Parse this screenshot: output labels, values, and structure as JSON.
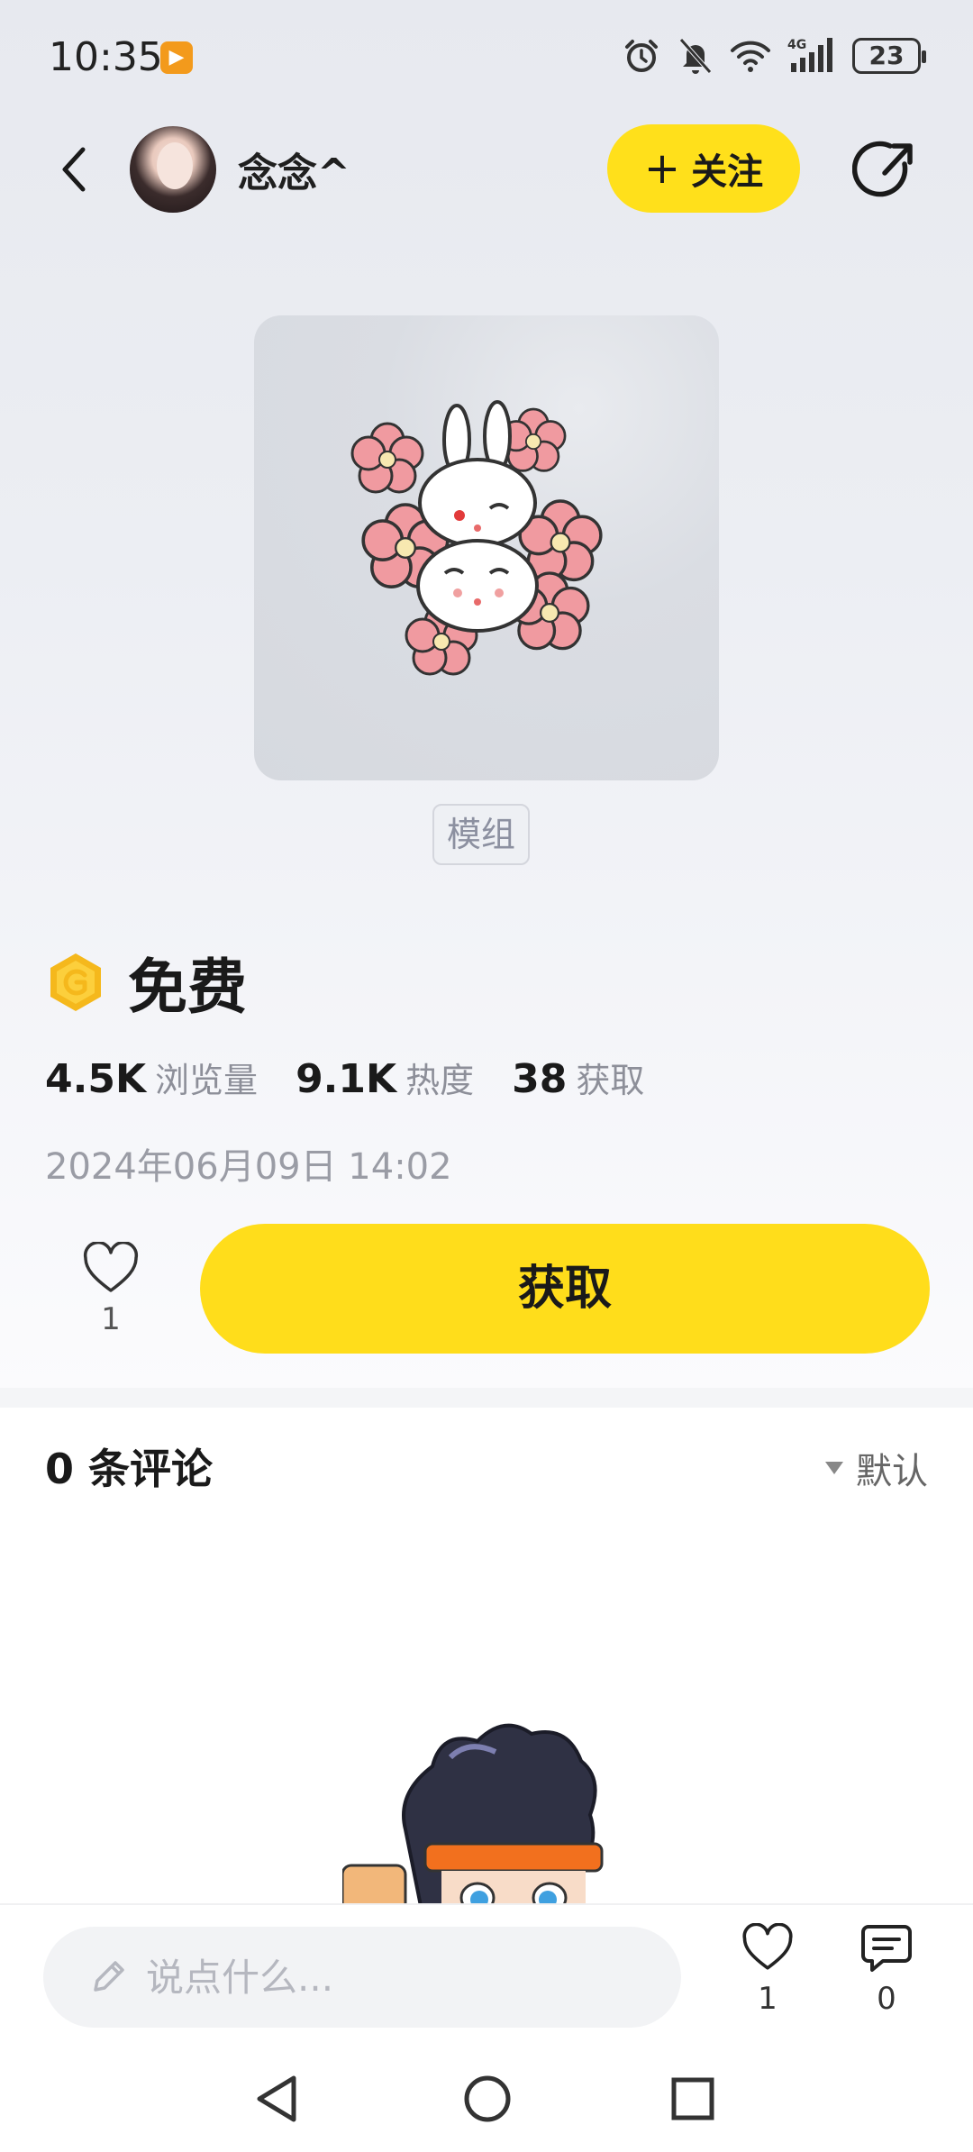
{
  "status_bar": {
    "time": "10:35",
    "battery": "23",
    "network": "4G"
  },
  "author": {
    "name": "念念^",
    "follow_label": "关注"
  },
  "item": {
    "tag": "模组",
    "price": "免费",
    "stats": [
      {
        "value": "4.5K",
        "label": "浏览量"
      },
      {
        "value": "9.1K",
        "label": "热度"
      },
      {
        "value": "38",
        "label": "获取"
      }
    ],
    "date": "2024年06月09日 14:02",
    "like_count": "1",
    "get_label": "获取"
  },
  "comments": {
    "header": "0 条评论",
    "sort_label": "默认"
  },
  "bottom_bar": {
    "input_placeholder": "说点什么...",
    "like_count": "1",
    "comment_count": "0"
  },
  "colors": {
    "accent": "#ffdd1b",
    "coin": "#f5b81c"
  }
}
